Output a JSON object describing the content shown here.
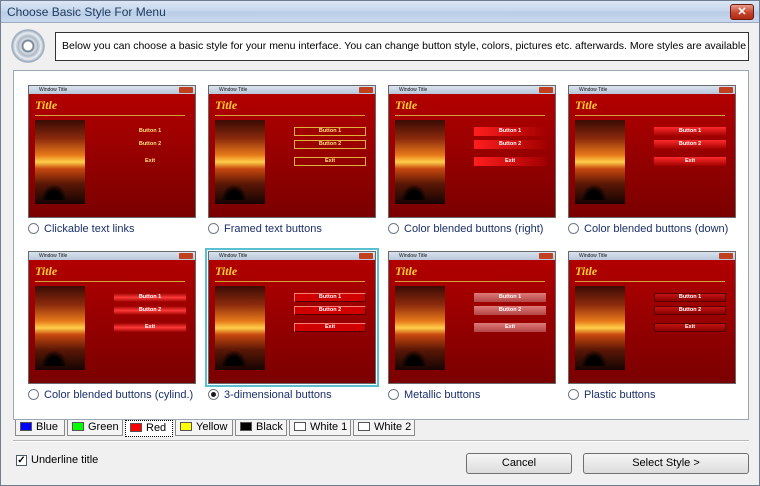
{
  "window": {
    "title": "Choose Basic Style For Menu",
    "close_label": "✕"
  },
  "description": "Below you can choose a basic style for your menu interface. You can change button style, colors, pictures etc. afterwards. More styles are available in the editor.",
  "preview": {
    "window_title": "Window Title",
    "title": "Title",
    "button1": "Button 1",
    "button2": "Button 2",
    "exit": "Exit"
  },
  "styles": [
    {
      "label": "Clickable text links",
      "selected": false
    },
    {
      "label": "Framed text buttons",
      "selected": false
    },
    {
      "label": "Color blended buttons (right)",
      "selected": false
    },
    {
      "label": "Color blended buttons (down)",
      "selected": false
    },
    {
      "label": "Color blended buttons (cylind.)",
      "selected": false
    },
    {
      "label": "3-dimensional buttons",
      "selected": true
    },
    {
      "label": "Metallic buttons",
      "selected": false
    },
    {
      "label": "Plastic buttons",
      "selected": false
    }
  ],
  "color_tabs": [
    {
      "label": "Blue",
      "color": "#0000ff",
      "active": false
    },
    {
      "label": "Green",
      "color": "#00ff00",
      "active": false
    },
    {
      "label": "Red",
      "color": "#ff0000",
      "active": true
    },
    {
      "label": "Yellow",
      "color": "#ffff00",
      "active": false
    },
    {
      "label": "Black",
      "color": "#000000",
      "active": false
    },
    {
      "label": "White 1",
      "color": "#ffffff",
      "active": false
    },
    {
      "label": "White 2",
      "color": "#ffffff",
      "active": false
    }
  ],
  "underline_title": {
    "label": "Underline title",
    "checked": true,
    "mark": "✓"
  },
  "buttons": {
    "cancel": "Cancel",
    "select": "Select Style >"
  }
}
